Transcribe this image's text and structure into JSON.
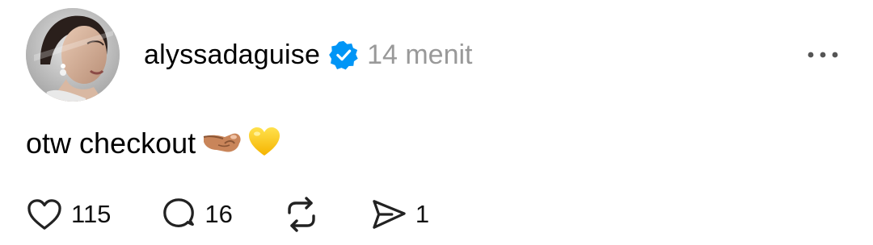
{
  "post": {
    "username": "alyssadaguise",
    "verified": true,
    "timestamp": "14 menit",
    "text": "otw checkout",
    "emojis": [
      "pinching-hand-emoji",
      "yellow-heart-emoji"
    ],
    "colors": {
      "verified_badge": "#0095F6",
      "timestamp": "#999999",
      "text": "#000000"
    }
  },
  "actions": {
    "like_count": "115",
    "reply_count": "16",
    "repost_count": "",
    "share_count": "1"
  },
  "icons": [
    "more-options-icon",
    "heart-icon",
    "comment-icon",
    "repost-icon",
    "share-icon"
  ]
}
